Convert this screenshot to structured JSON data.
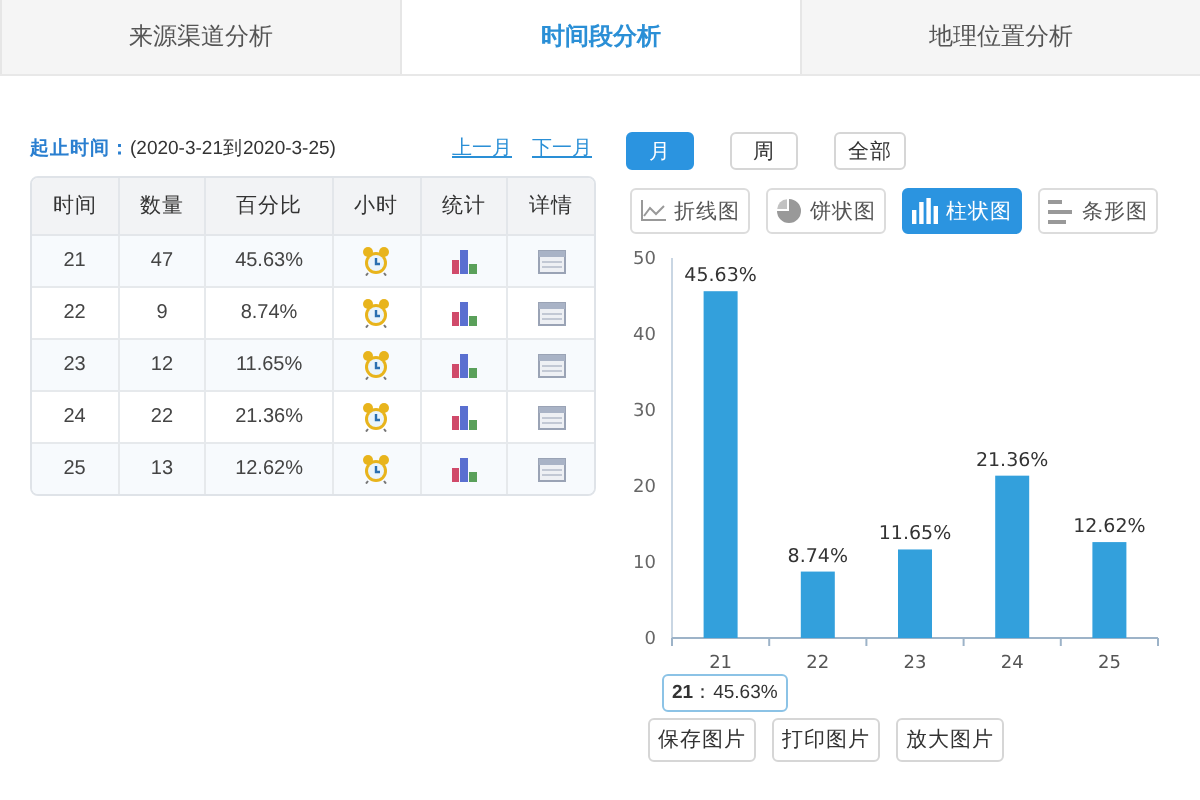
{
  "tabs": [
    {
      "label": "来源渠道分析",
      "selected": false
    },
    {
      "label": "时间段分析",
      "selected": true
    },
    {
      "label": "地理位置分析",
      "selected": false
    }
  ],
  "range": {
    "label": "起止时间：",
    "value": "(2020-3-21到2020-3-25)"
  },
  "nav_links": [
    "上一月",
    "下一月"
  ],
  "table": {
    "columns": [
      "时间",
      "数量",
      "百分比",
      "小时",
      "统计",
      "详情"
    ],
    "rows": [
      {
        "time": "21",
        "count": "47",
        "percent": "45.63%"
      },
      {
        "time": "22",
        "count": "9",
        "percent": "8.74%"
      },
      {
        "time": "23",
        "count": "12",
        "percent": "11.65%"
      },
      {
        "time": "24",
        "count": "22",
        "percent": "21.36%"
      },
      {
        "time": "25",
        "count": "13",
        "percent": "12.62%"
      }
    ]
  },
  "periods": [
    {
      "label": "月",
      "selected": true
    },
    {
      "label": "周",
      "selected": false
    },
    {
      "label": "全部",
      "selected": false
    }
  ],
  "chart_types": [
    {
      "kind": "line",
      "label": "折线图",
      "selected": false
    },
    {
      "kind": "pie",
      "label": "饼状图",
      "selected": false
    },
    {
      "kind": "column",
      "label": "柱状图",
      "selected": true
    },
    {
      "kind": "bar",
      "label": "条形图",
      "selected": false
    }
  ],
  "chart": {
    "chart_data": {
      "type": "bar",
      "categories": [
        "21",
        "22",
        "23",
        "24",
        "25"
      ],
      "values": [
        45.63,
        8.74,
        11.65,
        21.36,
        12.62
      ],
      "ylim": [
        0,
        50
      ],
      "yticks": [
        0,
        10,
        20,
        30,
        40,
        50
      ],
      "value_labels": [
        "45.63%",
        "8.74%",
        "11.65%",
        "21.36%",
        "12.62%"
      ]
    },
    "tooltip": {
      "category": "21",
      "separator": "：",
      "value": "45.63%"
    }
  },
  "actions": [
    "保存图片",
    "打印图片",
    "放大图片"
  ]
}
